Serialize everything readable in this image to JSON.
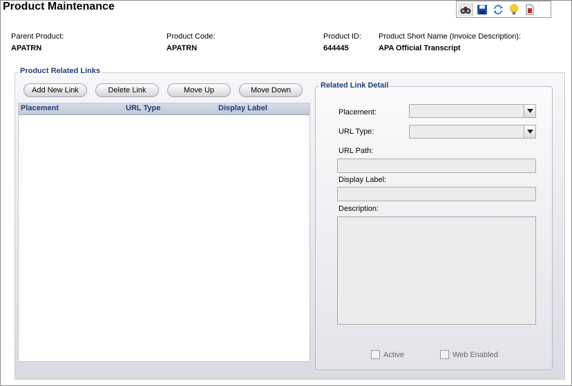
{
  "page": {
    "title": "Product Maintenance"
  },
  "toolbar": {
    "icons": [
      "binoculars-icon",
      "save-icon",
      "refresh-icon",
      "lightbulb-icon",
      "document-icon"
    ]
  },
  "product_info": {
    "parent_product": {
      "label": "Parent Product:",
      "value": "APATRN"
    },
    "product_code": {
      "label": "Product Code:",
      "value": "APATRN"
    },
    "product_id": {
      "label": "Product ID:",
      "value": "644445"
    },
    "short_name": {
      "label": "Product Short Name (Invoice Description):",
      "value": "APA Official Transcript"
    }
  },
  "related_links": {
    "title": "Product Related Links",
    "buttons": {
      "add": "Add New Link",
      "delete": "Delete Link",
      "move_up": "Move Up",
      "move_down": "Move Down"
    },
    "columns": [
      "Placement",
      "URL Type",
      "Display Label"
    ],
    "rows": []
  },
  "detail": {
    "title": "Related Link Detail",
    "placement_label": "Placement:",
    "placement_value": "",
    "url_type_label": "URL Type:",
    "url_type_value": "",
    "url_path_label": "URL Path:",
    "url_path_value": "",
    "display_label_label": "Display Label:",
    "display_label_value": "",
    "description_label": "Description:",
    "description_value": "",
    "active_label": "Active",
    "active_checked": false,
    "web_enabled_label": "Web Enabled",
    "web_enabled_checked": false
  },
  "colors": {
    "accent": "#1f3f7a",
    "grid_header": "#c3cad8",
    "input_bg": "#ececec"
  }
}
